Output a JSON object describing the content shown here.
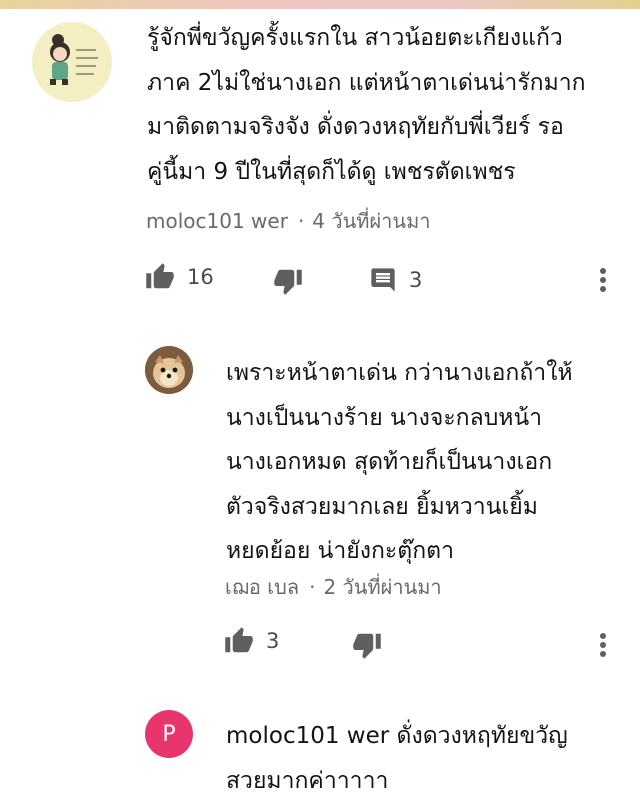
{
  "comments": [
    {
      "text": "รู้จักพี่ขวัญครั้งแรกใน สาวน้อยตะเกียงแก้ว\nภาค 2ไม่ใช่นางเอก แต่หน้าตาเด่นน่ารักมาก\nมาติดตามจริงจัง ดั่งดวงหฤทัยกับพี่เวียร์ รอ\nคู่นี้มา 9 ปีในที่สุดก็ได้ดู เพชรตัดเพชร",
      "author": "moloc101 wer",
      "time": "4 วันที่ผ่านมา",
      "likes": "16",
      "replies": "3",
      "avatar_icon": "cartoon-girl-avatar"
    },
    {
      "text": "เพราะหน้าตาเด่น กว่านางเอกถ้าให้\nนางเป็นนางร้าย นางจะกลบหน้า\nนางเอกหมด สุดท้ายก็เป็นนางเอก\nตัวจริงสวยมากเลย ยิ้มหวานเยิ้ม\nหยดย้อย น่ายังกะตุ๊กตา",
      "author": "เฌอ เบล",
      "time": "2 วันที่ผ่านมา",
      "likes": "3",
      "avatar_icon": "puppy-photo-avatar"
    },
    {
      "text": "moloc101 wer ดั่งดวงหฤทัยขวัญ\nสวยมากค่าาาาา",
      "avatar_letter": "P",
      "avatar_color": "#e8356d"
    }
  ],
  "colors": {
    "text": "#131313",
    "meta": "#6a6a6a",
    "icon": "#5f5f5f"
  }
}
